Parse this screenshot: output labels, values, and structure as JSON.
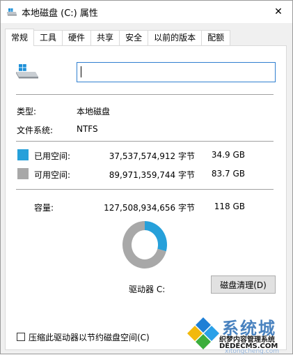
{
  "window": {
    "title": "本地磁盘 (C:) 属性",
    "close_glyph": "✕"
  },
  "tabs": [
    {
      "label": "常规",
      "active": true
    },
    {
      "label": "工具",
      "active": false
    },
    {
      "label": "硬件",
      "active": false
    },
    {
      "label": "共享",
      "active": false
    },
    {
      "label": "安全",
      "active": false
    },
    {
      "label": "以前的版本",
      "active": false
    },
    {
      "label": "配额",
      "active": false
    }
  ],
  "general": {
    "name_value": "",
    "type_label": "类型:",
    "type_value": "本地磁盘",
    "fs_label": "文件系统:",
    "fs_value": "NTFS",
    "used": {
      "label": "已用空间:",
      "bytes": "37,537,574,912 字节",
      "size": "34.9 GB",
      "color": "#26a0da"
    },
    "free": {
      "label": "可用空间:",
      "bytes": "89,971,359,744 字节",
      "size": "83.7 GB",
      "color": "#a8a8a8"
    },
    "capacity": {
      "label": "容量:",
      "bytes": "127,508,934,656 字节",
      "size": "118 GB"
    },
    "drive_label": "驱动器 C:",
    "cleanup_button": "磁盘清理(D)",
    "compress_checkbox": "压缩此驱动器以节约磁盘空间(C)",
    "compress_checked": false
  },
  "chart_data": {
    "type": "pie",
    "categories": [
      "已用空间",
      "可用空间"
    ],
    "values": [
      37537574912,
      89971359744
    ],
    "colors": [
      "#26a0da",
      "#a8a8a8"
    ]
  },
  "watermark": {
    "big_text": "系统城",
    "small_text": "织梦内容管理系统",
    "url_text": "DEDECMS.COM",
    "faint_text": "xitongcheng.com"
  },
  "icons": {
    "title_icon": "drive-icon",
    "drive_icon": "drive-icon",
    "close_icon": "close-icon",
    "watermark_logo": "windows-logo-icon"
  }
}
